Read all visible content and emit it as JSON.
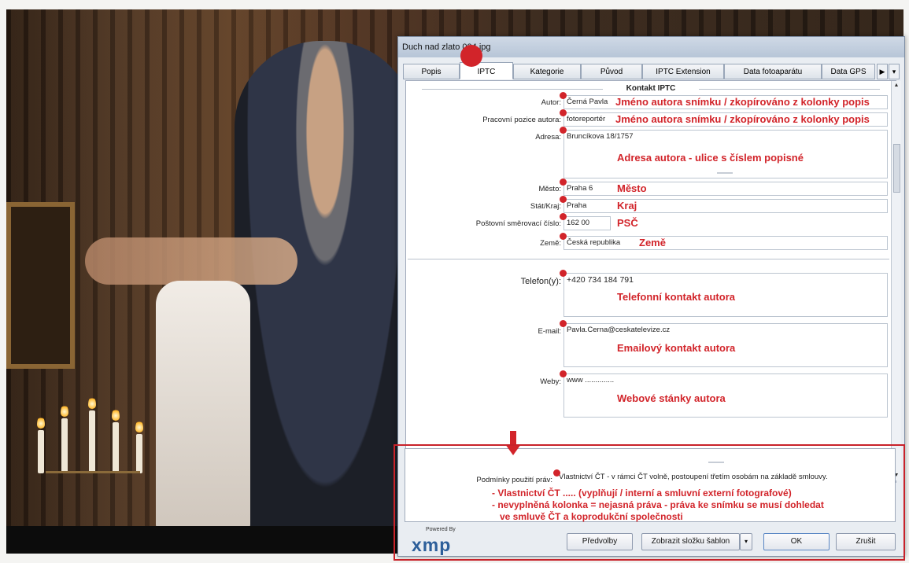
{
  "window": {
    "title": "Duch nad zlato 004.jpg"
  },
  "tabs": [
    {
      "label": "Popis"
    },
    {
      "label": "IPTC"
    },
    {
      "label": "Kategorie"
    },
    {
      "label": "Původ"
    },
    {
      "label": "IPTC Extension"
    },
    {
      "label": "Data fotoaparátu"
    },
    {
      "label": "Data GPS"
    }
  ],
  "section": {
    "title": "Kontakt IPTC"
  },
  "fields": {
    "autor": {
      "label": "Autor:",
      "value": "Černá Pavla",
      "note": "Jméno autora snímku / zkopírováno z kolonky popis"
    },
    "pozice": {
      "label": "Pracovní pozice autora:",
      "value": "fotoreportér",
      "note": "Jméno autora snímku / zkopírováno z kolonky popis"
    },
    "adresa": {
      "label": "Adresa:",
      "value": "Bruncíkova 18/1757",
      "note": "Adresa autora - ulice s číslem popisné"
    },
    "mesto": {
      "label": "Město:",
      "value": "Praha 6",
      "note": "Město"
    },
    "kraj": {
      "label": "Stát/Kraj:",
      "value": "Praha",
      "note": "Kraj"
    },
    "psc": {
      "label": "Poštovní směrovací číslo:",
      "value": "162 00",
      "note": "PSČ"
    },
    "zeme": {
      "label": "Země:",
      "value": "Česká republika",
      "note": "Země"
    },
    "telefon": {
      "label": "Telefon(y):",
      "value": "+420 734 184 791",
      "note": "Telefonní kontakt autora"
    },
    "email": {
      "label": "E-mail:",
      "value": "Pavla.Cerna@ceskatelevize.cz",
      "note": "Emailový kontakt autora"
    },
    "weby": {
      "label": "Weby:",
      "value": "www ..............",
      "note": "Webové stánky autora"
    },
    "prava": {
      "label": "Podmínky použití práv:",
      "value": "Vlastnictví ČT - v rámci ČT volně, postoupení třetím osobám na základě smlouvy."
    }
  },
  "rights_notes": [
    "- Vlastnictví ČT ..... (vyplňují / interní a smluvní externí fotografové)",
    "- nevyplněná kolonka = nejasná práva - práva ke snímku se musí dohledat",
    "ve smluvě ČT a koprodukční společnosti"
  ],
  "footer": {
    "powered_by": "Powered By",
    "logo": "xmp",
    "buttons": {
      "predvolby": "Předvolby",
      "sablon": "Zobrazit složku šablon",
      "ok": "OK",
      "zrusit": "Zrušit"
    }
  },
  "colors": {
    "annotation": "#d2242a",
    "dialog_bg": "#e9edf2",
    "logo": "#2d5f9a"
  }
}
